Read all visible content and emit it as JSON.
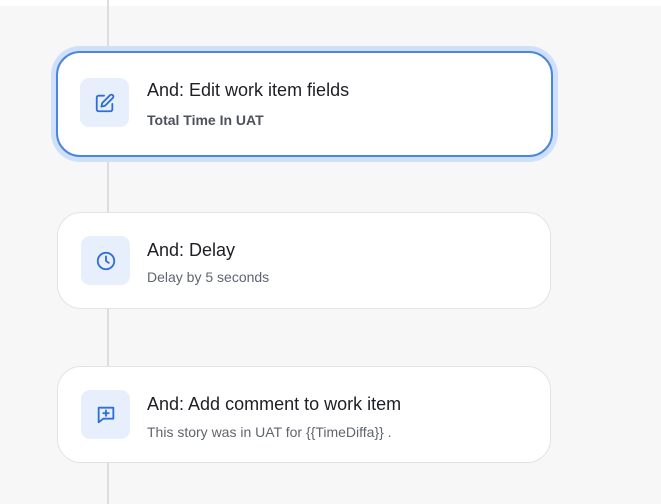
{
  "steps": [
    {
      "title": "And: Edit work item fields",
      "subtitle": "Total Time In UAT",
      "icon": "edit-icon",
      "selected": true
    },
    {
      "title": "And: Delay",
      "subtitle": "Delay by 5 seconds",
      "icon": "clock-icon",
      "selected": false
    },
    {
      "title": "And: Add comment to work item",
      "subtitle": "This story was in UAT for {{TimeDiffa}} .",
      "icon": "comment-add-icon",
      "selected": false
    }
  ],
  "colors": {
    "accent": "#4a86e0",
    "icon_bg": "#e7effd",
    "icon_stroke": "#2f6fd6"
  }
}
